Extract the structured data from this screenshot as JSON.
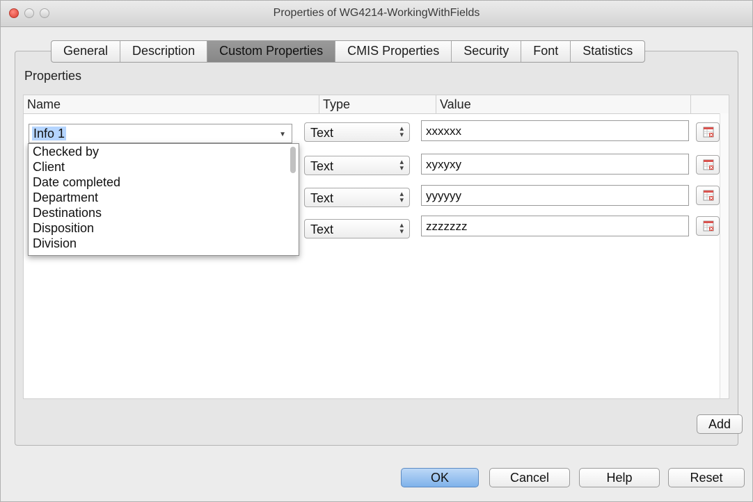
{
  "window": {
    "title": "Properties of WG4214-WorkingWithFields"
  },
  "tabs": [
    {
      "label": "General"
    },
    {
      "label": "Description"
    },
    {
      "label": "Custom Properties"
    },
    {
      "label": "CMIS Properties"
    },
    {
      "label": "Security"
    },
    {
      "label": "Font"
    },
    {
      "label": "Statistics"
    }
  ],
  "active_tab": "Custom Properties",
  "section_label": "Properties",
  "columns": {
    "name": "Name",
    "type": "Type",
    "value": "Value"
  },
  "name_combo": {
    "value": "Info 1"
  },
  "dropdown_options": [
    "Checked by",
    "Client",
    "Date completed",
    "Department",
    "Destinations",
    "Disposition",
    "Division"
  ],
  "rows": [
    {
      "type": "Text",
      "value": "xxxxxx"
    },
    {
      "type": "Text",
      "value": "xyxyxy"
    },
    {
      "type": "Text",
      "value": "yyyyyy"
    },
    {
      "type": "Text",
      "value": "zzzzzzz"
    }
  ],
  "buttons": {
    "add": "Add",
    "ok": "OK",
    "cancel": "Cancel",
    "help": "Help",
    "reset": "Reset"
  },
  "colors": {
    "selection": "#b5d5ff",
    "default_button": "#7fb2ea",
    "active_tab": "#8f8f8f"
  }
}
